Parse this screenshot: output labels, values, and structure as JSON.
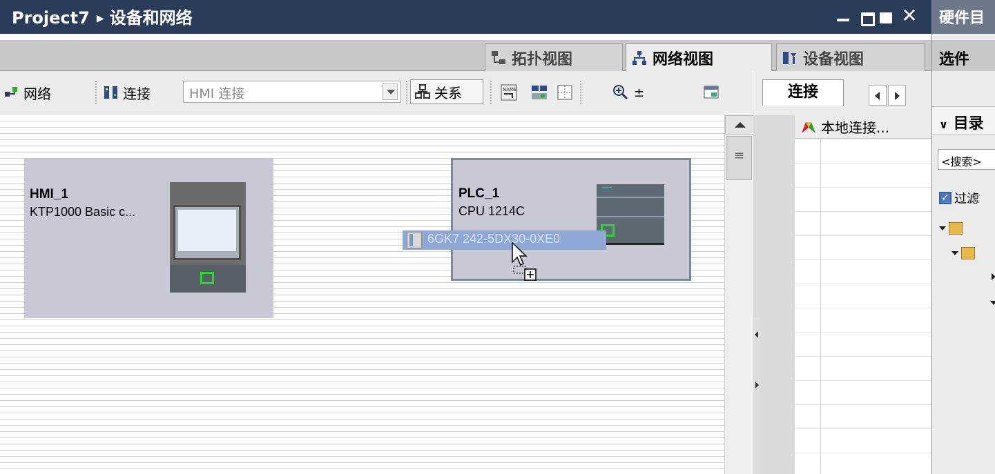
{
  "window": {
    "project": "Project7",
    "title": "设备和网络"
  },
  "view_tabs": {
    "topology": "拓扑视图",
    "network": "网络视图",
    "device": "设备视图"
  },
  "toolbar": {
    "network_label": "网络",
    "connect_label": "连接",
    "connection_type": "HMI 连接",
    "relation_label": "关系"
  },
  "devices": {
    "hmi": {
      "name": "HMI_1",
      "type": "KTP1000 Basic c..."
    },
    "plc": {
      "name": "PLC_1",
      "type": "CPU 1214C"
    }
  },
  "drag_item": {
    "label": "6GK7 242-5DX30-0XE0"
  },
  "connections_panel": {
    "tab_label": "连接",
    "column_header": "本地连接..."
  },
  "catalog": {
    "title": "硬件目",
    "options_label": "选件",
    "section_label": "目录",
    "search_placeholder": "<搜索>",
    "filter_label": "过滤"
  },
  "colors": {
    "title_bar": "#2a3c5a",
    "device_fill": "#c9c9d6",
    "port_green": "#22dd22",
    "drag_highlight": "#8fa7d4"
  }
}
